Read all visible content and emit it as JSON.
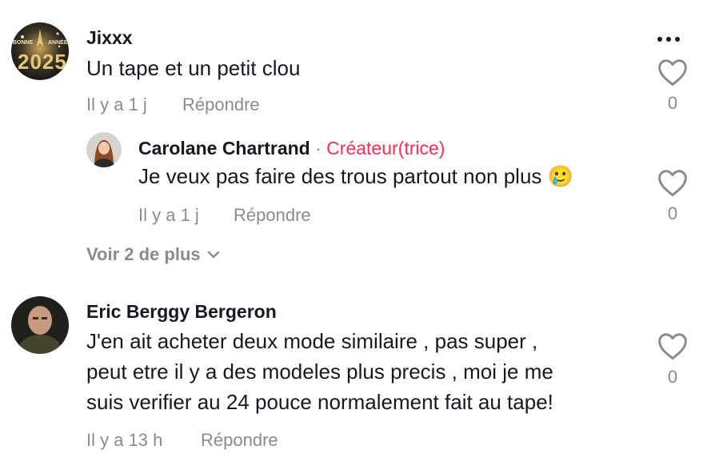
{
  "comments": [
    {
      "username": "Jixxx",
      "text": "Un tape et un petit clou",
      "time": "Il y a 1 j",
      "reply_label": "Répondre",
      "likes": "0",
      "avatar_text": [
        "BONNE",
        "ANNÉE",
        "2025"
      ],
      "replies": [
        {
          "username": "Carolane Chartrand",
          "separator": "·",
          "badge": "Créateur(trice)",
          "text": "Je veux pas faire des trous partout non plus 🥲",
          "time": "Il y a 1 j",
          "reply_label": "Répondre",
          "likes": "0"
        }
      ],
      "view_more_label": "Voir 2 de plus"
    },
    {
      "username": "Eric Berggy Bergeron",
      "text_lines": [
        "J'en ait acheter deux mode similaire , pas super ,",
        "peut etre il y a des modeles plus precis , moi je me",
        "suis verifier au 24 pouce normalement fait au tape!"
      ],
      "time": "Il y a 13 h",
      "reply_label": "Répondre",
      "likes": "0"
    }
  ],
  "colors": {
    "text": "#161823",
    "muted": "#8a8b91",
    "creator_badge": "#fe2c55",
    "background": "#ffffff"
  },
  "icons": {
    "heart": "heart-outline-icon",
    "more": "more-horizontal-icon",
    "view_more": "chevron-down-icon"
  }
}
